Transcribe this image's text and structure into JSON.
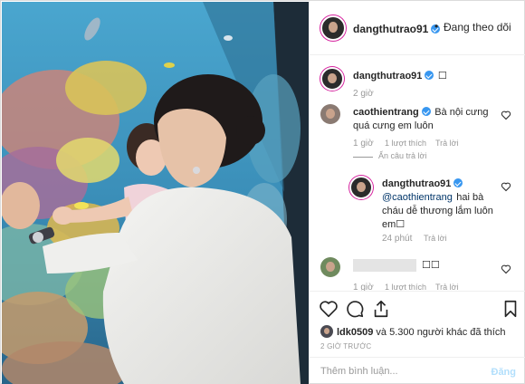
{
  "header": {
    "username": "dangthutrao91",
    "separator": "•",
    "follow_status": "Đang theo dõi"
  },
  "caption": {
    "username": "dangthutrao91",
    "text": "☐",
    "time": "2 giờ"
  },
  "comments": [
    {
      "username": "caothientrang",
      "text": "Bà nội cưng quá cưng em luôn",
      "time": "1 giờ",
      "likes": "1 lượt thích",
      "reply_label": "Trả lời",
      "toggle_replies": "Ẩn câu trả lời"
    },
    {
      "username": "dangthutrao91",
      "mention": "@caothientrang",
      "text": "hai bà cháu dễ thương lắm luôn em☐",
      "time": "24 phút",
      "reply_label": "Trả lời"
    },
    {
      "username": "",
      "text": "☐☐",
      "time": "1 giờ",
      "likes": "1 lượt thích",
      "reply_label": "Trả lời"
    }
  ],
  "actions": {
    "likes_user": "ldk0509",
    "likes_rest": " và 5.300 người khác đã thích",
    "time_ago": "2 GIỜ TRƯỚC"
  },
  "add_comment": {
    "placeholder": "Thêm bình luận...",
    "post_label": "Đăng"
  },
  "colors": {
    "verified": "#3897f0",
    "story_ring": "#d6249f",
    "muted_text": "#999999",
    "post_disabled": "#b2dffc"
  }
}
